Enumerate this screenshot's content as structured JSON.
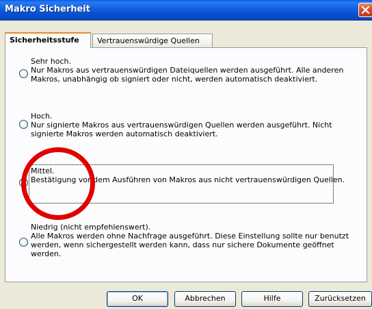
{
  "window": {
    "title": "Makro Sicherheit"
  },
  "tabs": [
    {
      "label": "Sicherheitsstufe",
      "active": true
    },
    {
      "label": "Vertrauenswürdige Quellen",
      "active": false
    }
  ],
  "options": [
    {
      "label": "Sehr hoch.",
      "description": "Nur Makros aus vertrauenswürdigen Dateiquellen werden ausgeführt. Alle anderen Makros, unabhängig ob signiert oder nicht, werden automatisch deaktiviert.",
      "selected": false
    },
    {
      "label": "Hoch.",
      "description": "Nur signierte Makros aus vertrauenswürdigen Quellen werden ausgeführt. Nicht signierte Makros werden automatisch deaktiviert.",
      "selected": false
    },
    {
      "label": "Mittel.",
      "description": "Bestätigung vor dem Ausführen von Makros aus nicht vertrauenswürdigen Quellen.",
      "selected": true
    },
    {
      "label": "Niedrig (nicht empfehlenswert).",
      "description": "Alle Makros werden ohne Nachfrage ausgeführt. Diese Einstellung sollte nur benutzt werden, wenn sichergestellt werden kann, dass nur sichere Dokumente geöffnet werden.",
      "selected": false
    }
  ],
  "buttons": {
    "ok": "OK",
    "cancel": "Abbrechen",
    "help": "Hilfe",
    "reset": "Zurücksetzen"
  },
  "colors": {
    "titlebar": "#0e5fe3",
    "annotation_circle": "#e00000",
    "dialog_bg": "#ece9d8"
  }
}
